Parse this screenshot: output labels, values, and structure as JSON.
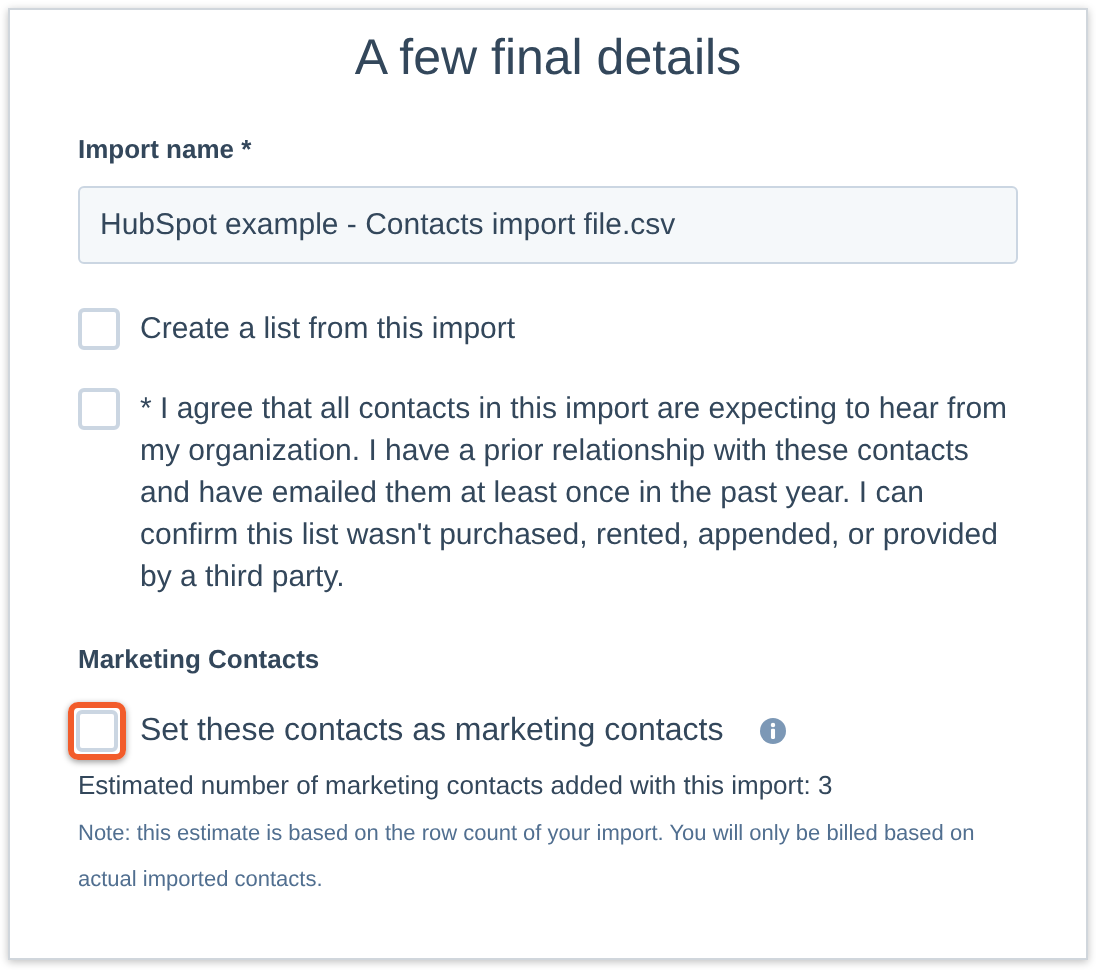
{
  "title": "A few final details",
  "import_name": {
    "label": "Import name *",
    "value": "HubSpot example - Contacts import file.csv"
  },
  "options": [
    {
      "label": "Create a list from this import",
      "checked": false
    },
    {
      "label": "* I agree that all contacts in this import are expecting to hear from my organization. I have a prior relationship with these contacts and have emailed them at least once in the past year. I can confirm this list wasn't purchased, rented, appended, or provided by a third party.",
      "checked": false
    }
  ],
  "marketing": {
    "heading": "Marketing Contacts",
    "checkbox": {
      "label": "Set these contacts as marketing contacts",
      "checked": false,
      "highlighted": true
    },
    "estimate": "Estimated number of marketing contacts added with this import: 3",
    "note": "Note: this estimate is based on the row count of your import. You will only be billed based on actual imported contacts."
  }
}
